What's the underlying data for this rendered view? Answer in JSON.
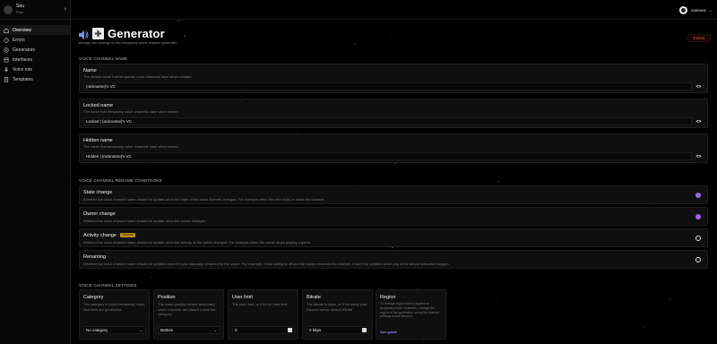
{
  "server": {
    "name": "Seu",
    "plan": "Free"
  },
  "nav": [
    {
      "label": "Overview",
      "icon": "home-icon"
    },
    {
      "label": "Errors",
      "icon": "alert-icon"
    },
    {
      "label": "Generators",
      "icon": "plus-circle-icon"
    },
    {
      "label": "Interfaces",
      "icon": "layout-icon"
    },
    {
      "label": "Voice role",
      "icon": "mic-icon"
    },
    {
      "label": "Templates",
      "icon": "template-icon"
    }
  ],
  "user": {
    "name": "zaneoxx"
  },
  "page": {
    "title": "Generator",
    "subtitle": "Manage the settings of this temporary voice channel generator",
    "delete_label": "Delete"
  },
  "sections": {
    "name": "VOICE CHANNEL NAME",
    "rename": "VOICE CHANNEL RENAME CONDITIONS",
    "settings": "VOICE CHANNEL SETTINGS"
  },
  "names": [
    {
      "label": "Name",
      "desc": "The default name that temporary voice channels have when created",
      "value": "{nickname}'s VC"
    },
    {
      "label": "Locked name",
      "desc": "The name that temporary voice channels have when locked",
      "value": "Locked | {nickname}'s VC"
    },
    {
      "label": "Hidden name",
      "desc": "The name that temporary voice channels have when hidden",
      "value": "Hidden | {nickname}'s VC"
    }
  ],
  "conditions": [
    {
      "label": "State change",
      "desc": "Whether the voice channel name should be update when the state of the voice channel changes. For exemple when the user locks or hides the channel",
      "on": true
    },
    {
      "label": "Owner change",
      "desc": "Whether the voice channel name should be update when the owner changes",
      "on": true
    },
    {
      "label": "Activity change",
      "badge": "Ultimate",
      "desc": "Whether the voice channel name should be update when the activity of the owner changes. For example when the owner stops playing a game",
      "on": false
    },
    {
      "label": "Renaming",
      "desc": "Whether the voice channel name should be updated even if it was manually renamed by the owner. For example, if this setting is off and the owner renames the channel, it won't be updated when any of the above scenarios happen.",
      "on": false
    }
  ],
  "settings": {
    "category": {
      "label": "Category",
      "desc": "The category in which temporary voice channels are generated.",
      "value": "No category"
    },
    "position": {
      "label": "Position",
      "desc": "The exact position where temporary voice channels are placed inside the category.",
      "value": "Bottom"
    },
    "user_limit": {
      "label": "User limit",
      "desc": "The user limit, or 0 for no user limit",
      "value": "0"
    },
    "bitrate": {
      "label": "Bitrate",
      "desc": "The bitrate in kbps, or 0 for using your Discord server default bitrate",
      "value": "0 kbps"
    },
    "region": {
      "label": "Region",
      "desc": "To change region that is applied to temporary voice channels, change the region of the generator, using the channel settings inside Discord.",
      "link": "See guide"
    }
  },
  "icons": {
    "code": "<>",
    "chevron": "›",
    "select_chevron": "⌄"
  },
  "colors": {
    "toggle_on": "#a362f2",
    "delete": "#e04848",
    "badge": "#c48a1a",
    "link": "#9a7dff"
  }
}
